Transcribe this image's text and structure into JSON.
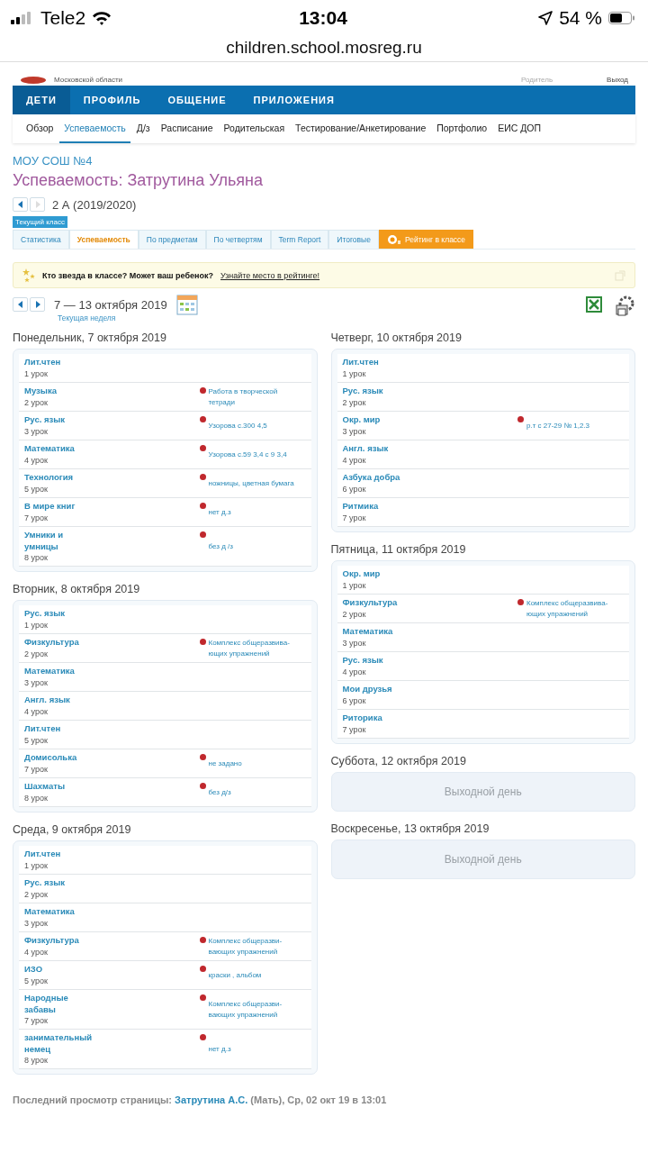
{
  "status_bar": {
    "carrier": "Tele2",
    "time": "13:04",
    "battery": "54 %"
  },
  "url": "children.school.mosreg.ru",
  "site_header": {
    "region": "Московской области",
    "role": "Родитель",
    "logout": "Выход"
  },
  "main_nav": [
    {
      "label": "ДЕТИ",
      "selected": true
    },
    {
      "label": "ПРОФИЛЬ",
      "selected": false
    },
    {
      "label": "ОБЩЕНИЕ",
      "selected": false
    },
    {
      "label": "ПРИЛОЖЕНИЯ",
      "selected": false
    }
  ],
  "sub_nav": [
    {
      "label": "Обзор",
      "selected": false
    },
    {
      "label": "Успеваемость",
      "selected": true
    },
    {
      "label": "Д/з",
      "selected": false
    },
    {
      "label": "Расписание",
      "selected": false
    },
    {
      "label": "Родительская",
      "selected": false
    },
    {
      "label": "Тестирование/Анкетирование",
      "selected": false
    },
    {
      "label": "Портфолио",
      "selected": false
    },
    {
      "label": "ЕИС ДОП",
      "selected": false
    }
  ],
  "school": "МОУ СОШ №4",
  "title": "Успеваемость: Затрутина Ульяна",
  "class_nav": {
    "prev_disabled": false,
    "next_disabled": true,
    "label": "2 А (2019/2020)",
    "badge": "Текущий класс"
  },
  "tabs": [
    {
      "label": "Статистика",
      "kind": "tab",
      "selected": false
    },
    {
      "label": "Успеваемость",
      "kind": "tab",
      "selected": true
    },
    {
      "label": "По предметам",
      "kind": "tab",
      "selected": false
    },
    {
      "label": "По четвертям",
      "kind": "tab",
      "selected": false
    },
    {
      "label": "Term Report",
      "kind": "tab",
      "selected": false
    },
    {
      "label": "Итоговые",
      "kind": "tab",
      "selected": false
    },
    {
      "label": "Рейтинг в классе",
      "kind": "rating",
      "selected": false
    }
  ],
  "banner": {
    "text": "Кто звезда в классе? Может ваш ребенок?",
    "link": "Узнайте место в рейтинге!"
  },
  "week": {
    "range": "7 — 13 октября 2019",
    "current": "Текущая неделя"
  },
  "columns": [
    {
      "days": [
        {
          "title": "Понедельник, 7 октября 2019",
          "kind": "lessons",
          "lessons": [
            {
              "subject": "Лит.чтен",
              "number": "1 урок"
            },
            {
              "subject": "Музыка",
              "number": "2 урок",
              "homework": "Работа в творческой тетради"
            },
            {
              "subject": "Рус. язык",
              "number": "3 урок",
              "homework": "Узорова с.300 4,5"
            },
            {
              "subject": "Математика",
              "number": "4 урок",
              "homework": "Узорова с.59 3,4 с 9 3,4"
            },
            {
              "subject": "Технология",
              "number": "5 урок",
              "homework": "ножницы, цветная бумага"
            },
            {
              "subject": "В мире книг",
              "number": "7 урок",
              "homework": "нет д.з"
            },
            {
              "subject": "Умники и умницы",
              "number": "8 урок",
              "homework": "без д /з"
            }
          ]
        },
        {
          "title": "Вторник, 8 октября 2019",
          "kind": "lessons",
          "lessons": [
            {
              "subject": "Рус. язык",
              "number": "1 урок"
            },
            {
              "subject": "Физкультура",
              "number": "2 урок",
              "homework": "Комплекс общеразвива-ющих упражнений"
            },
            {
              "subject": "Математика",
              "number": "3 урок"
            },
            {
              "subject": "Англ. язык",
              "number": "4 урок"
            },
            {
              "subject": "Лит.чтен",
              "number": "5 урок"
            },
            {
              "subject": "Домисолька",
              "number": "7 урок",
              "homework": "не задано"
            },
            {
              "subject": "Шахматы",
              "number": "8 урок",
              "homework": "без д/з"
            }
          ]
        },
        {
          "title": "Среда, 9 октября 2019",
          "kind": "lessons",
          "lessons": [
            {
              "subject": "Лит.чтен",
              "number": "1 урок"
            },
            {
              "subject": "Рус. язык",
              "number": "2 урок"
            },
            {
              "subject": "Математика",
              "number": "3 урок"
            },
            {
              "subject": "Физкультура",
              "number": "4 урок",
              "homework": "Комплекс общеразви-вающих упражнений"
            },
            {
              "subject": "ИЗО",
              "number": "5 урок",
              "homework": "краски , альбом"
            },
            {
              "subject": "Народные забавы",
              "number": "7 урок",
              "homework": "Комплекс общеразви-вающих упражнений"
            },
            {
              "subject": "занимательный немец",
              "number": "8 урок",
              "homework": "нет д.з"
            }
          ]
        }
      ]
    },
    {
      "days": [
        {
          "title": "Четверг, 10 октября 2019",
          "kind": "lessons",
          "lessons": [
            {
              "subject": "Лит.чтен",
              "number": "1 урок"
            },
            {
              "subject": "Рус. язык",
              "number": "2 урок"
            },
            {
              "subject": "Окр. мир",
              "number": "3 урок",
              "homework": "р.т с 27-29 № 1,2.3"
            },
            {
              "subject": "Англ. язык",
              "number": "4 урок"
            },
            {
              "subject": "Азбука добра",
              "number": "6 урок"
            },
            {
              "subject": "Ритмика",
              "number": "7 урок"
            }
          ]
        },
        {
          "title": "Пятница, 11 октября 2019",
          "kind": "lessons",
          "lessons": [
            {
              "subject": "Окр. мир",
              "number": "1 урок"
            },
            {
              "subject": "Физкультура",
              "number": "2 урок",
              "homework": "Комплекс общеразвива-ющих упражнений"
            },
            {
              "subject": "Математика",
              "number": "3 урок"
            },
            {
              "subject": "Рус. язык",
              "number": "4 урок"
            },
            {
              "subject": "Мои друзья",
              "number": "6 урок"
            },
            {
              "subject": "Риторика",
              "number": "7 урок"
            }
          ]
        },
        {
          "title": "Суббота, 12 октября 2019",
          "kind": "holiday",
          "text": "Выходной день"
        },
        {
          "title": "Воскресенье, 13 октября 2019",
          "kind": "holiday",
          "text": "Выходной день"
        }
      ]
    }
  ],
  "footer": {
    "label": "Последний просмотр страницы:",
    "name": "Затрутина А.С.",
    "rest": "(Мать), Ср, 02 окт 19 в 13:01"
  }
}
